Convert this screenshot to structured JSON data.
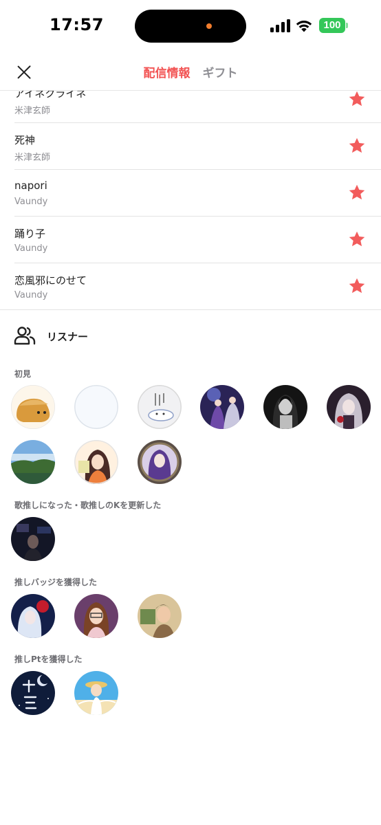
{
  "status_bar": {
    "time": "17:57",
    "battery": "100",
    "icons": [
      "cellular-signal-icon",
      "wifi-icon",
      "battery-icon"
    ]
  },
  "header": {
    "close_icon": "close-icon",
    "tabs": [
      {
        "label": "配信情報",
        "active": true
      },
      {
        "label": "ギフト",
        "active": false
      }
    ]
  },
  "songs": [
    {
      "title": "アイネクライネ",
      "artist": "米津玄師",
      "favorite": true
    },
    {
      "title": "死神",
      "artist": "米津玄師",
      "favorite": true
    },
    {
      "title": "napori",
      "artist": "Vaundy",
      "favorite": true
    },
    {
      "title": "踊り子",
      "artist": "Vaundy",
      "favorite": true
    },
    {
      "title": "恋風邪にのせて",
      "artist": "Vaundy",
      "favorite": true
    }
  ],
  "listeners": {
    "title": "リスナー",
    "icon": "users-icon",
    "sections": [
      {
        "label": "初見",
        "count": 9
      },
      {
        "label": "歌推しになった・歌推しのKを更新した",
        "count": 1
      },
      {
        "label": "推しバッジを獲得した",
        "count": 3
      },
      {
        "label": "推しPtを獲得した",
        "count": 2
      }
    ]
  },
  "colors": {
    "accent": "#f25353",
    "star": "#f25c5c",
    "battery": "#34c759",
    "muted_text": "#8e8e93"
  }
}
